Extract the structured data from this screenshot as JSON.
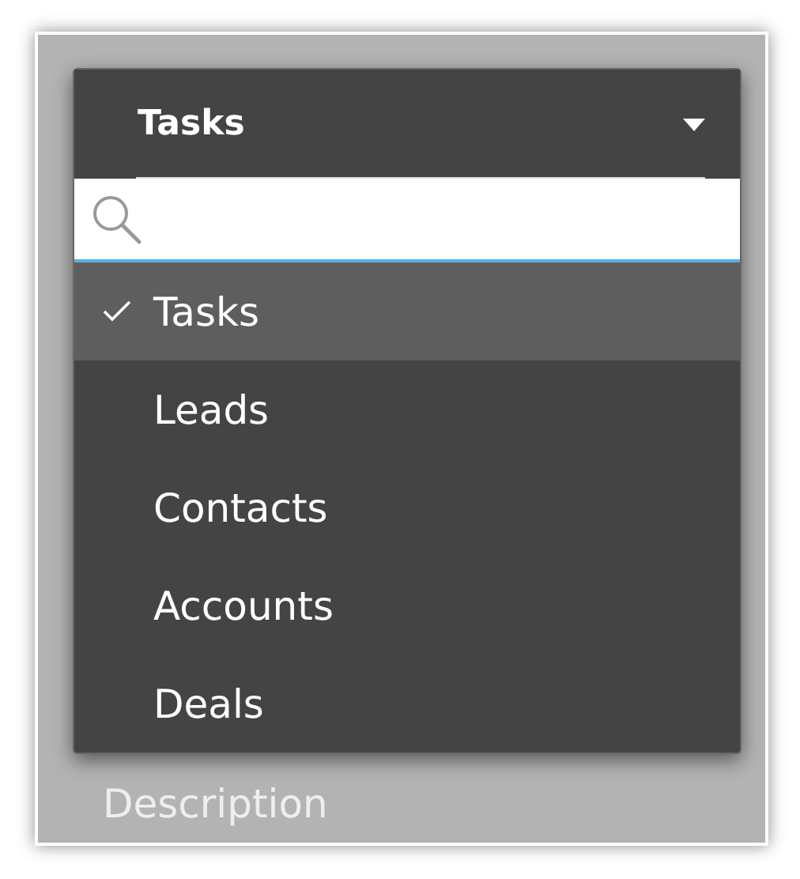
{
  "dropdown": {
    "value": "Tasks",
    "items": [
      {
        "label": "Tasks",
        "selected": true
      },
      {
        "label": "Leads",
        "selected": false
      },
      {
        "label": "Contacts",
        "selected": false
      },
      {
        "label": "Accounts",
        "selected": false
      },
      {
        "label": "Deals",
        "selected": false
      }
    ]
  },
  "behind": {
    "label": "Description"
  }
}
